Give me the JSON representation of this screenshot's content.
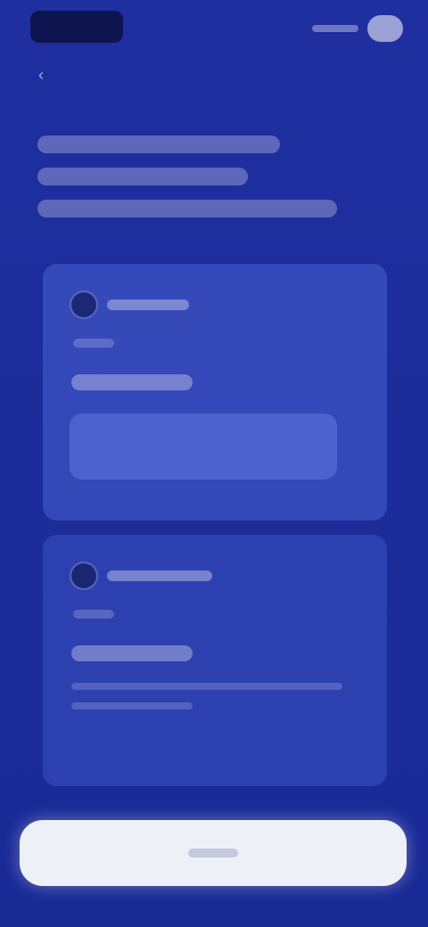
{
  "app": {
    "brand_color": "#1e2d9c",
    "card_color": "#4860d2",
    "cta_color": "#eef0f8"
  },
  "header": {
    "logo_icon": "app-logo",
    "back_icon": "chevron-left-icon"
  },
  "icons": {
    "card_icon": "circle-badge-icon"
  }
}
